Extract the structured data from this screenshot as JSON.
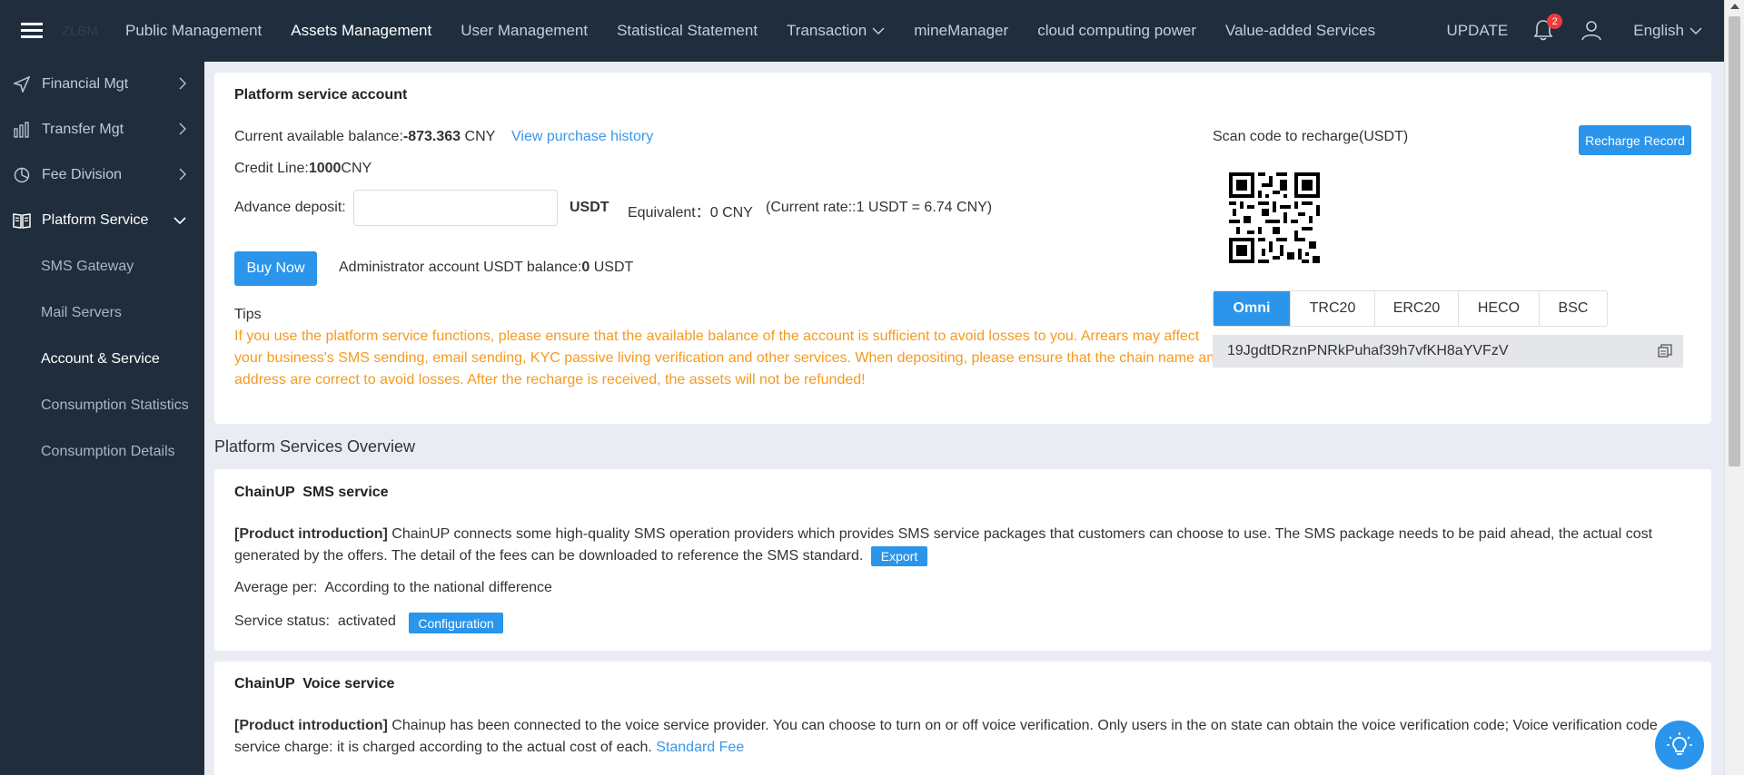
{
  "header": {
    "logo": "ZLBM",
    "nav": [
      {
        "label": "Public Management"
      },
      {
        "label": "Assets Management"
      },
      {
        "label": "User Management"
      },
      {
        "label": "Statistical Statement"
      },
      {
        "label": "Transaction"
      },
      {
        "label": "mineManager"
      },
      {
        "label": "cloud computing power"
      },
      {
        "label": "Value-added Services"
      }
    ],
    "update_label": "UPDATE",
    "notification_count": "2",
    "language": "English"
  },
  "sidebar": {
    "items": [
      {
        "label": "Financial Mgt"
      },
      {
        "label": "Transfer Mgt"
      },
      {
        "label": "Fee Division"
      },
      {
        "label": "Platform Service"
      }
    ],
    "sub_items": [
      {
        "label": "SMS Gateway"
      },
      {
        "label": "Mail Servers"
      },
      {
        "label": "Account & Service"
      },
      {
        "label": "Consumption Statistics"
      },
      {
        "label": "Consumption Details"
      }
    ]
  },
  "account": {
    "title": "Platform service account",
    "balance_label": "Current available balance:",
    "balance_value": "-873.363",
    "balance_unit": "CNY",
    "purchase_history_link": "View purchase history",
    "credit_label": "Credit Line:",
    "credit_value": "1000",
    "credit_unit": "CNY",
    "deposit_label": "Advance deposit:",
    "deposit_value": "",
    "deposit_currency": "USDT",
    "equivalent": "Equivalent：0 CNY",
    "rate": "(Current rate::1 USDT = 6.74 CNY)",
    "buy_now": "Buy Now",
    "admin_balance_label": "Administrator account USDT balance:",
    "admin_balance_value": "0",
    "admin_balance_unit": "USDT",
    "tips_label": "Tips",
    "tips_text": "If you use the platform service functions, please ensure that the available balance of the account is sufficient to avoid losses to you. Arrears may affect your business's SMS sending, email sending, KYC passive living verification and other services. When depositing, please ensure that the chain name and address are correct to avoid losses. After the recharge is received, the assets will not be refunded!",
    "scan_label": "Scan code to recharge(USDT)",
    "recharge_record": "Recharge Record",
    "chains": [
      {
        "label": "Omni"
      },
      {
        "label": "TRC20"
      },
      {
        "label": "ERC20"
      },
      {
        "label": "HECO"
      },
      {
        "label": "BSC"
      }
    ],
    "address": "19JgdtDRznPNRkPuhaf39h7vfKH8aYVFzV"
  },
  "overview": {
    "title": "Platform Services Overview",
    "sms": {
      "title": "ChainUP  SMS service",
      "intro_label": "[Product introduction]",
      "intro_text": " ChainUP connects some high-quality SMS operation providers which provides SMS service packages that customers can choose to use. The SMS package needs to be paid ahead, the actual cost generated by the offers. The detail of the fees can be downloaded to reference the SMS standard.",
      "export": "Export",
      "average_label": "Average per:",
      "average_value": "According to the national difference",
      "status_label": "Service status:",
      "status_value": "activated",
      "configuration": "Configuration"
    },
    "voice": {
      "title": "ChainUP  Voice service",
      "intro_label": "[Product introduction]",
      "intro_text": " Chainup has been connected to the voice service provider. You can choose to turn on or off voice verification. Only users in the on state can obtain the voice verification code; Voice verification code service charge: it is charged according to the actual cost of each.",
      "standard_fee": "Standard Fee"
    }
  }
}
